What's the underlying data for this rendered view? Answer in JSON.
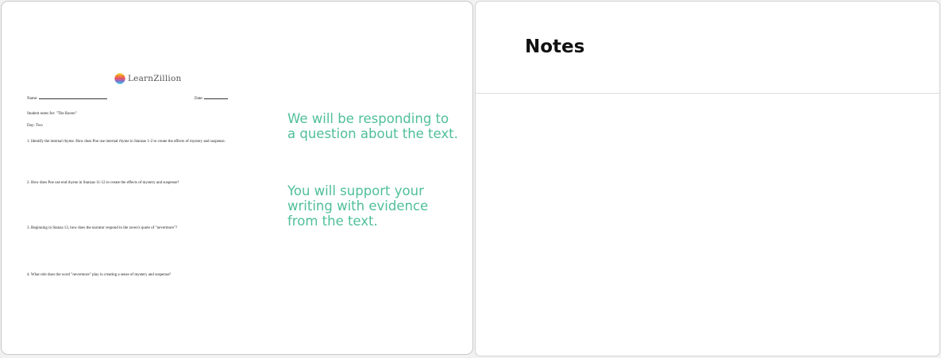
{
  "slide": {
    "logo": {
      "name": "LearnZillion",
      "icon": "learnzillion-logo-icon"
    },
    "worksheet": {
      "name_label": "Name:",
      "date_label": "Date:",
      "notes_for": "Student notes for: \"The Raven\"",
      "day": "Day: Two",
      "questions": [
        "1. Identify the internal rhyme.  How does Poe use internal rhyme in Stanzas 1-2 to create the effects of mystery and suspense.",
        "2. How does Poe use end rhyme in Stanzas 11-12 to create the effects of mystery and suspense?",
        "3. Beginning in Stanza 13, how does the narrator respond to the raven's quote of \"nevermore\"?",
        "4. What role does the word \"nevermore\" play in creating a sense of mystery and suspense?"
      ]
    },
    "overlay": {
      "paragraph1": "We will be responding to a question about the text.",
      "paragraph2": "You will support your writing with evidence from the text."
    },
    "colors": {
      "overlay_text": "#4fbf9a"
    }
  },
  "notes": {
    "title": "Notes"
  }
}
